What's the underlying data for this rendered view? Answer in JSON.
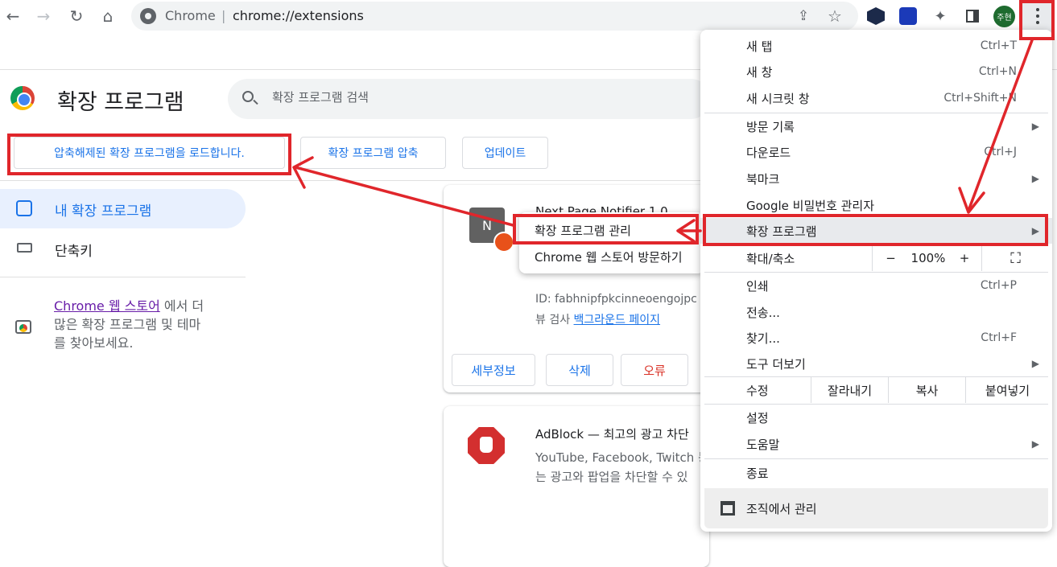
{
  "browser": {
    "omnibox_label": "Chrome",
    "url": "chrome://extensions",
    "avatar_text": "주현"
  },
  "page": {
    "title": "확장 프로그램",
    "search_placeholder": "확장 프로그램 검색"
  },
  "dev_buttons": {
    "load_unpacked": "압축해제된 확장 프로그램을 로드합니다.",
    "pack": "확장 프로그램 압축",
    "update": "업데이트"
  },
  "sidebar": {
    "items": [
      {
        "label": "내 확장 프로그램"
      },
      {
        "label": "단축키"
      }
    ],
    "store_link": "Chrome 웹 스토어",
    "store_text_1": "에서 더",
    "store_text_2": "많은 확장 프로그램 및 테마",
    "store_text_3": "를 찾아보세요."
  },
  "cards": [
    {
      "icon_letter": "N",
      "name": "Next Page Notifier  1.0",
      "id_line": "ID: fabhnipfpkcinneoengojpc",
      "view_prefix": "뷰 검사",
      "view_link": "백그라운드 페이지",
      "buttons": {
        "details": "세부정보",
        "remove": "삭제",
        "errors": "오류"
      }
    },
    {
      "name": "AdBlock — 최고의 광고 차단",
      "desc_1": "YouTube, Facebook, Twitch 등",
      "desc_2": "는 광고와 팝업을 차단할 수 있"
    }
  ],
  "submenu": {
    "manage": "확장 프로그램 관리",
    "store": "Chrome 웹 스토어 방문하기"
  },
  "menu": {
    "new_tab": {
      "label": "새 탭",
      "shortcut": "Ctrl+T"
    },
    "new_window": {
      "label": "새 창",
      "shortcut": "Ctrl+N"
    },
    "incognito": {
      "label": "새 시크릿 창",
      "shortcut": "Ctrl+Shift+N"
    },
    "history": {
      "label": "방문 기록"
    },
    "downloads": {
      "label": "다운로드",
      "shortcut": "Ctrl+J"
    },
    "bookmarks": {
      "label": "북마크"
    },
    "passwords": {
      "label": "Google 비밀번호 관리자"
    },
    "extensions": {
      "label": "확장 프로그램"
    },
    "zoom": {
      "label": "확대/축소",
      "minus": "−",
      "value": "100%",
      "plus": "+"
    },
    "print": {
      "label": "인쇄",
      "shortcut": "Ctrl+P"
    },
    "cast": {
      "label": "전송..."
    },
    "find": {
      "label": "찾기...",
      "shortcut": "Ctrl+F"
    },
    "more_tools": {
      "label": "도구 더보기"
    },
    "edit": {
      "label": "수정",
      "cut": "잘라내기",
      "copy": "복사",
      "paste": "붙여넣기"
    },
    "settings": {
      "label": "설정"
    },
    "help": {
      "label": "도움말"
    },
    "exit": {
      "label": "종료"
    },
    "managed": {
      "label": "조직에서 관리"
    }
  },
  "colors": {
    "accent": "#1a73e8",
    "annotation": "#e0262b"
  }
}
